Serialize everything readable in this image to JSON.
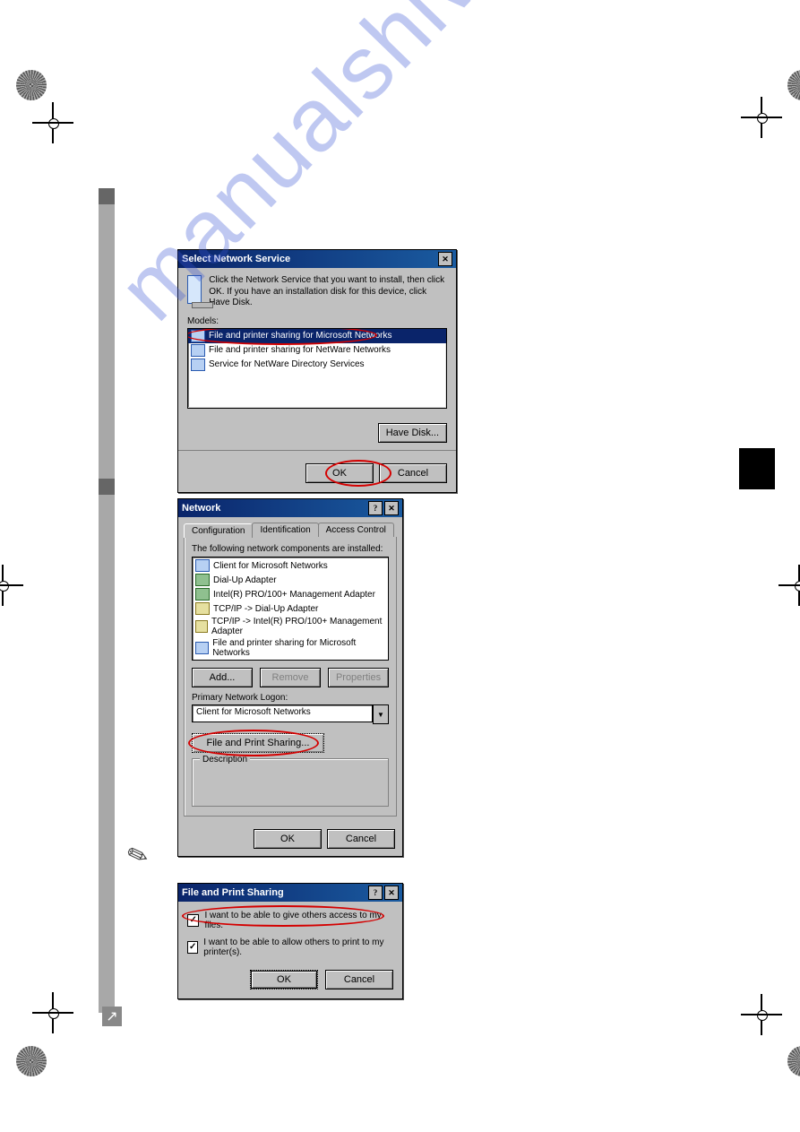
{
  "watermark": "manualshive.com",
  "dialog1": {
    "title": "Select Network Service",
    "instruction": "Click the Network Service that you want to install, then click OK. If you have an installation disk for this device, click Have Disk.",
    "models_label": "Models:",
    "items": [
      "File and printer sharing for Microsoft Networks",
      "File and printer sharing for NetWare Networks",
      "Service for NetWare Directory Services"
    ],
    "have_disk": "Have Disk...",
    "ok": "OK",
    "cancel": "Cancel"
  },
  "dialog2": {
    "title": "Network",
    "tabs": [
      "Configuration",
      "Identification",
      "Access Control"
    ],
    "components_label": "The following network components are installed:",
    "components": [
      "Client for Microsoft Networks",
      "Dial-Up Adapter",
      "Intel(R) PRO/100+ Management Adapter",
      "TCP/IP -> Dial-Up Adapter",
      "TCP/IP -> Intel(R) PRO/100+ Management Adapter",
      "File and printer sharing for Microsoft Networks"
    ],
    "add": "Add...",
    "remove": "Remove",
    "properties": "Properties",
    "primary_label": "Primary Network Logon:",
    "primary_value": "Client for Microsoft Networks",
    "fps_button": "File and Print Sharing...",
    "description_label": "Description",
    "ok": "OK",
    "cancel": "Cancel"
  },
  "dialog3": {
    "title": "File and Print Sharing",
    "opt_files": "I want to be able to give others access to my files.",
    "opt_print": "I want to be able to allow others to print to my printer(s).",
    "ok": "OK",
    "cancel": "Cancel"
  }
}
